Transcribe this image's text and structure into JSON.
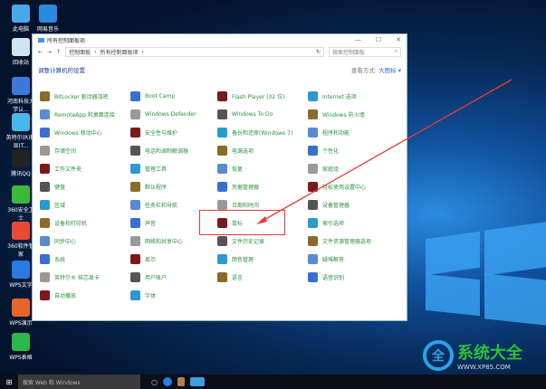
{
  "desktop_icons": [
    {
      "label": "此电脑",
      "color": "#4aa8e8"
    },
    {
      "label": "网易音乐",
      "color": "#2a8ae0"
    },
    {
      "label": "回收站",
      "color": "#cfe4f4"
    },
    {
      "label": "河南科技大学认...",
      "color": "#3b7ad8"
    },
    {
      "label": "英特尔(R)核显(T...",
      "color": "#48b8e8"
    },
    {
      "label": "腾讯QQ",
      "color": "#222"
    },
    {
      "label": "360安全卫士",
      "color": "#3cb83c"
    },
    {
      "label": "360软件管家",
      "color": "#e84a3a"
    },
    {
      "label": "WPS文字",
      "color": "#2a7ae0"
    },
    {
      "label": "WPS演示",
      "color": "#e8652a"
    },
    {
      "label": "WPS表格",
      "color": "#2ab84a"
    }
  ],
  "window": {
    "title": "所有控制面板项",
    "controls": [
      "—",
      "☐",
      "✕"
    ],
    "breadcrumb": [
      "控制面板",
      "所有控制面板项"
    ],
    "search_placeholder": "搜索控制面板",
    "heading": "调整计算机的设置",
    "view_label": "查看方式:",
    "view_value": "大图标 ▾"
  },
  "items": [
    [
      "BitLocker 驱动器加密",
      "Boot Camp",
      "Flash Player (32 位)",
      "Internet 选项"
    ],
    [
      "RemoteApp 和桌面连接",
      "Windows Defender",
      "Windows To Go",
      "Windows 防火墙"
    ],
    [
      "Windows 移动中心",
      "安全性与维护",
      "备份和还原(Windows 7)",
      "程序和功能"
    ],
    [
      "存储空间",
      "电话和调制解调器",
      "电源选项",
      "个性化"
    ],
    [
      "工作文件夹",
      "管理工具",
      "恢复",
      "家庭组"
    ],
    [
      "键盘",
      "默认程序",
      "凭据管理器",
      "轻松使用设置中心"
    ],
    [
      "区域",
      "任务栏和导航",
      "日期和时间",
      "设备管理器"
    ],
    [
      "设备和打印机",
      "声音",
      "鼠标",
      "索引选项"
    ],
    [
      "同步中心",
      "网络和共享中心",
      "文件历史记录",
      "文件资源管理器选项"
    ],
    [
      "系统",
      "显示",
      "颜色管理",
      "疑难解答"
    ],
    [
      "英特尔® 核芯显卡",
      "用户帐户",
      "语言",
      "语音识别"
    ],
    [
      "自动播放",
      "字体"
    ]
  ],
  "icon_colors": [
    "#8a6b2a",
    "#3a6fd0",
    "#7a1a1a",
    "#2a9ad0",
    "#5a8ad0",
    "#999",
    "#555"
  ],
  "taskbar": {
    "search": "搜索 Web 和 Windows"
  },
  "watermark": {
    "name": "系统大全",
    "url": "WWW.XP85.COM"
  },
  "highlight": {
    "color": "#e83a3a"
  }
}
